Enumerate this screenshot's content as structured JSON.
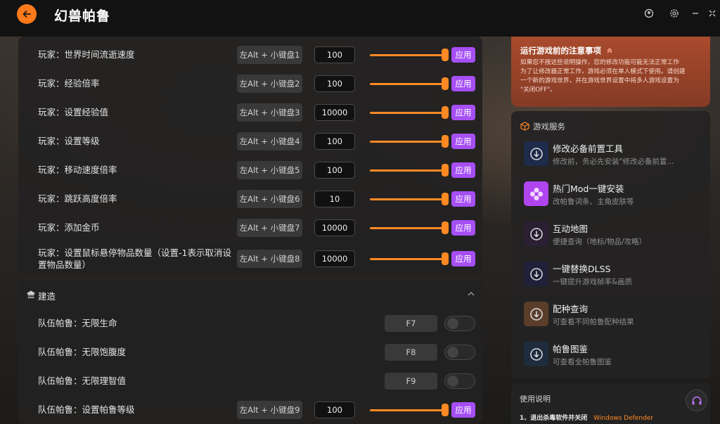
{
  "app": {
    "title": "幻兽帕鲁"
  },
  "player_rows": [
    {
      "label": "玩家：世界时间流逝速度",
      "key": "左Alt + 小键盘1",
      "value": "100",
      "apply": "应用"
    },
    {
      "label": "玩家：经验倍率",
      "key": "左Alt + 小键盘2",
      "value": "100",
      "apply": "应用"
    },
    {
      "label": "玩家：设置经验值",
      "key": "左Alt + 小键盘3",
      "value": "10000",
      "apply": "应用"
    },
    {
      "label": "玩家：设置等级",
      "key": "左Alt + 小键盘4",
      "value": "100",
      "apply": "应用"
    },
    {
      "label": "玩家：移动速度倍率",
      "key": "左Alt + 小键盘5",
      "value": "100",
      "apply": "应用"
    },
    {
      "label": "玩家：跳跃高度倍率",
      "key": "左Alt + 小键盘6",
      "value": "10",
      "apply": "应用"
    },
    {
      "label": "玩家：添加金币",
      "key": "左Alt + 小键盘7",
      "value": "10000",
      "apply": "应用"
    },
    {
      "label_line1": "玩家：设置鼠标悬停物品数量（设置-1表示取消设",
      "label_line2": "置物品数量）",
      "key": "左Alt + 小键盘8",
      "value": "10000",
      "apply": "应用"
    }
  ],
  "build_section": {
    "title": "建造",
    "rows": [
      {
        "label": "队伍帕鲁：无限生命",
        "key": "F7"
      },
      {
        "label": "队伍帕鲁：无限饱腹度",
        "key": "F8"
      },
      {
        "label": "队伍帕鲁：无限理智值",
        "key": "F9"
      },
      {
        "label": "队伍帕鲁：设置帕鲁等级",
        "key": "左Alt + 小键盘9",
        "value": "100",
        "apply": "应用"
      }
    ]
  },
  "notice": {
    "title": "运行游戏前的注意事项",
    "line1": "如果您不按这些说明操作，您的修改功能可能无法正常工作",
    "line2": "为了让修改器正常工作，游戏必须在单人模式下使用。请创建",
    "line3": "一个新的游戏世界，并在游戏世界设置中将多人游戏设置为",
    "line4": "\"关闭OFF\"。"
  },
  "services": {
    "title": "游戏服务",
    "items": [
      {
        "title": "修改必备前置工具",
        "desc": "修改前，务必先安装\"修改必备前置...",
        "icon": "download-icon",
        "color": "#1e2b4a"
      },
      {
        "title": "热门Mod一键安装",
        "desc": "改帕鲁词条、主角皮肤等",
        "icon": "mod-flower-icon",
        "color": "#b045f0"
      },
      {
        "title": "互动地图",
        "desc": "便捷查询（地标/物品/攻略）",
        "icon": "download-icon",
        "color": "#2a1f33"
      },
      {
        "title": "一键替换DLSS",
        "desc": "一键提升游戏帧率&画质",
        "icon": "download-icon",
        "color": "#20203a"
      },
      {
        "title": "配种查询",
        "desc": "可查看不同帕鲁配种结果",
        "icon": "download-icon",
        "color": "#5a3e2a"
      },
      {
        "title": "帕鲁图鉴",
        "desc": "可查看全帕鲁图鉴",
        "icon": "download-icon",
        "color": "#1e2c3e"
      }
    ]
  },
  "usage": {
    "title": "使用说明",
    "step1": "1、退出杀毒软件并关闭",
    "step1_highlight": "Windows Defender"
  },
  "colors": {
    "accent": "#ff8a24",
    "apply": "#a64ff5",
    "notice": "#a94a2c"
  }
}
